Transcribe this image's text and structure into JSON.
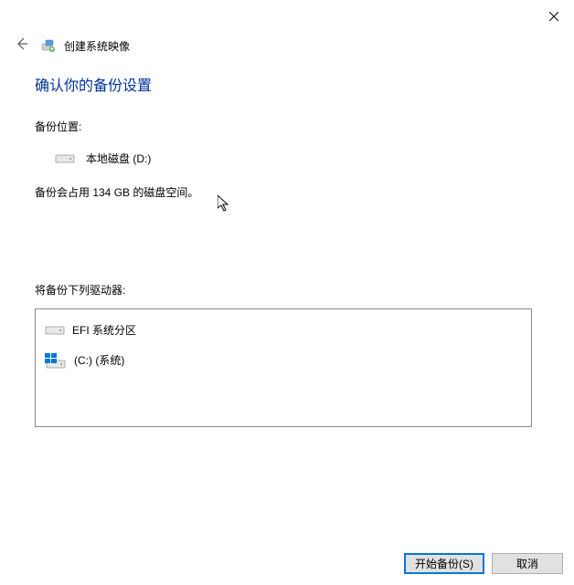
{
  "window": {
    "title": "创建系统映像"
  },
  "main": {
    "heading": "确认你的备份设置",
    "backup_location_label": "备份位置:",
    "backup_location_value": "本地磁盘 (D:)",
    "size_info": "备份会占用 134 GB 的磁盘空间。",
    "drives_label": "将备份下列驱动器:",
    "drives": [
      {
        "name": "EFI 系统分区",
        "icon": "hdd"
      },
      {
        "name": "(C:) (系统)",
        "icon": "windows-hdd"
      }
    ]
  },
  "footer": {
    "start_backup": "开始备份(S)",
    "cancel": "取消"
  }
}
